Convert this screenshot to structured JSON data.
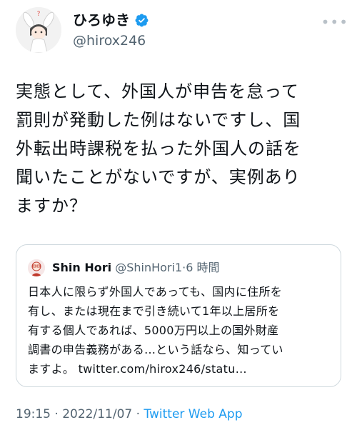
{
  "author": {
    "name": "ひろゆき",
    "handle": "@hirox246",
    "verified": true
  },
  "tweet": {
    "lines": [
      "実態として、外国人が申告を怠って",
      "罰則が発動した例はないですし、国",
      "外転出時課税を払った外国人の話を",
      "聞いたことがないですが、実例あり",
      "ますか？"
    ]
  },
  "quote": {
    "name": "Shin Hori",
    "handle": "@ShinHori1",
    "separator": "·",
    "time": "6 時間",
    "lines": [
      "日本人に限らず外国人であっても、国内に住所を",
      "有し、または現在まで引き続いて1年以上居所を",
      "有する個人であれば、5000万円以上の国外財産",
      "調書の申告義務がある…という話なら、知ってい",
      "ますよ。 twitter.com/hirox246/statu…"
    ]
  },
  "meta": {
    "time": "19:15",
    "separator1": " · ",
    "date": "2022/11/07",
    "separator2": " · ",
    "source": "Twitter Web App"
  },
  "colors": {
    "accent": "#1d9bf0",
    "secondary_text": "#536471",
    "border": "#cfd9de"
  },
  "icons": {
    "verified": "verified-badge-icon",
    "more": "more-icon"
  }
}
